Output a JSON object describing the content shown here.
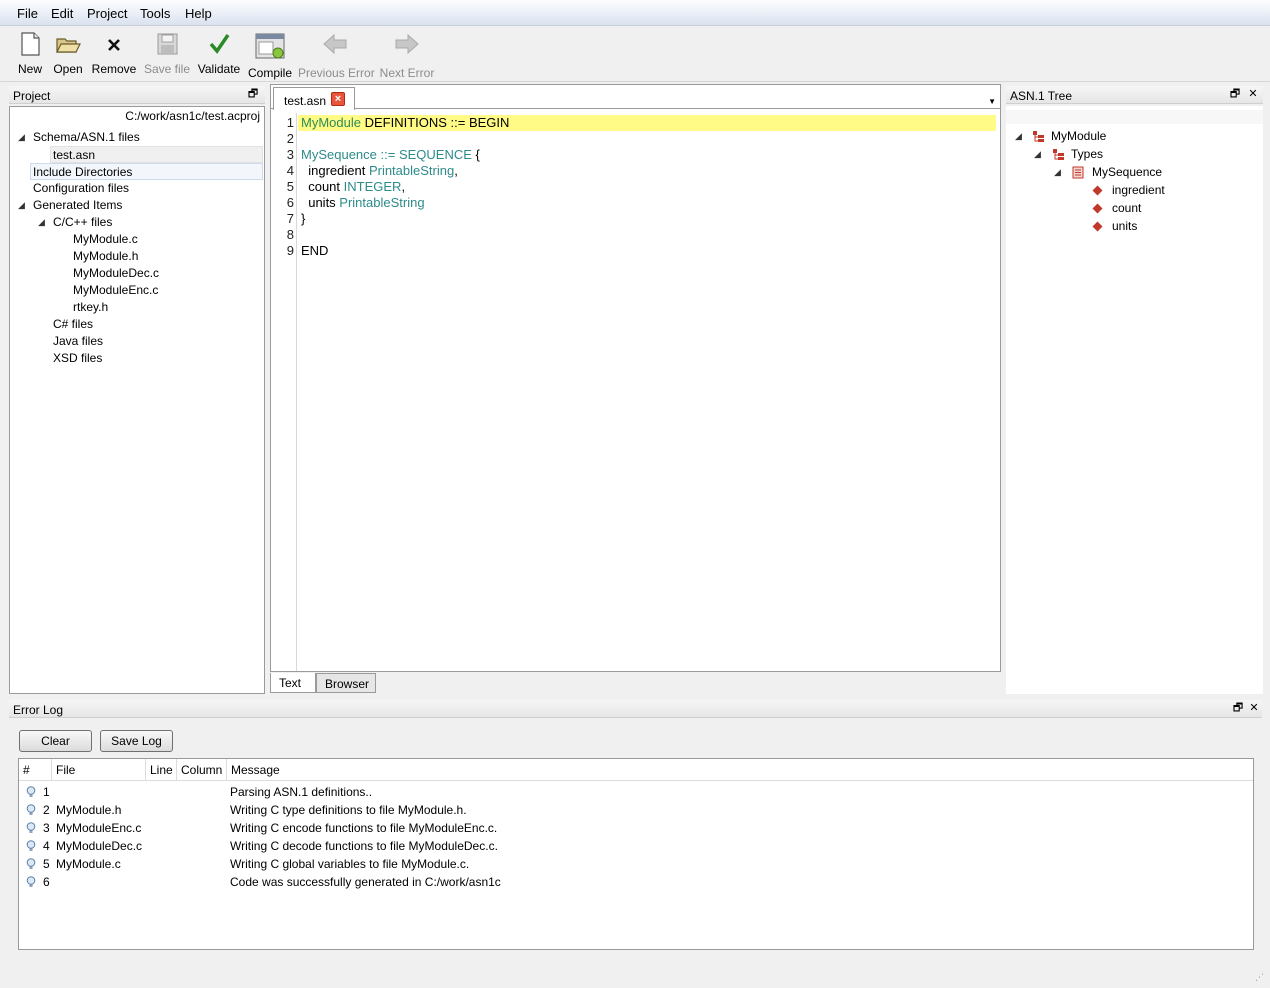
{
  "menu": [
    "File",
    "Edit",
    "Project",
    "Tools",
    "Help"
  ],
  "toolbar": {
    "new": "New",
    "open": "Open",
    "remove": "Remove",
    "save": "Save file",
    "validate": "Validate",
    "compile": "Compile",
    "prev_error": "Previous Error",
    "next_error": "Next Error"
  },
  "project": {
    "title": "Project",
    "path": "C:/work/asn1c/test.acproj",
    "tree": {
      "schema": "Schema/ASN.1 files",
      "test_asn": "test.asn",
      "include_dirs": "Include Directories",
      "config_files": "Configuration files",
      "generated": "Generated Items",
      "cpp_files": "C/C++ files",
      "files": [
        "MyModule.c",
        "MyModule.h",
        "MyModuleDec.c",
        "MyModuleEnc.c",
        "rtkey.h"
      ],
      "cs_files": "C# files",
      "java_files": "Java files",
      "xsd_files": "XSD files"
    }
  },
  "editor": {
    "tab": "test.asn",
    "line_numbers": [
      "1",
      "2",
      "3",
      "4",
      "5",
      "6",
      "7",
      "8",
      "9"
    ],
    "code": {
      "l1_a": "MyModule",
      "l1_b": " DEFINITIONS ::= BEGIN",
      "l3_a": "MySequence",
      "l3_b": " ::= ",
      "l3_c": "SEQUENCE",
      "l3_d": " {",
      "l4_a": "  ingredient ",
      "l4_b": "PrintableString",
      "l4_c": ",",
      "l5_a": "  count ",
      "l5_b": "INTEGER",
      "l5_c": ",",
      "l6_a": "  units ",
      "l6_b": "PrintableString",
      "l7": "}",
      "l9": "END"
    },
    "view_tabs": [
      "Text",
      "Browser"
    ]
  },
  "asn_tree": {
    "title": "ASN.1 Tree",
    "module": "MyModule",
    "types": "Types",
    "sequence": "MySequence",
    "fields": [
      "ingredient",
      "count",
      "units"
    ]
  },
  "error_log": {
    "title": "Error Log",
    "clear": "Clear",
    "save_log": "Save Log",
    "columns": [
      "#",
      "File",
      "Line",
      "Column",
      "Message"
    ],
    "rows": [
      {
        "num": "1",
        "file": "",
        "message": "Parsing ASN.1 definitions.."
      },
      {
        "num": "2",
        "file": "MyModule.h",
        "message": "Writing C type definitions to file MyModule.h."
      },
      {
        "num": "3",
        "file": "MyModuleEnc.c",
        "message": "Writing C encode functions to file MyModuleEnc.c."
      },
      {
        "num": "4",
        "file": "MyModuleDec.c",
        "message": "Writing C decode functions to file MyModuleDec.c."
      },
      {
        "num": "5",
        "file": "MyModule.c",
        "message": "Writing C global variables to file MyModule.c."
      },
      {
        "num": "6",
        "file": "",
        "message": "Code was successfully generated in C:/work/asn1c"
      }
    ]
  }
}
